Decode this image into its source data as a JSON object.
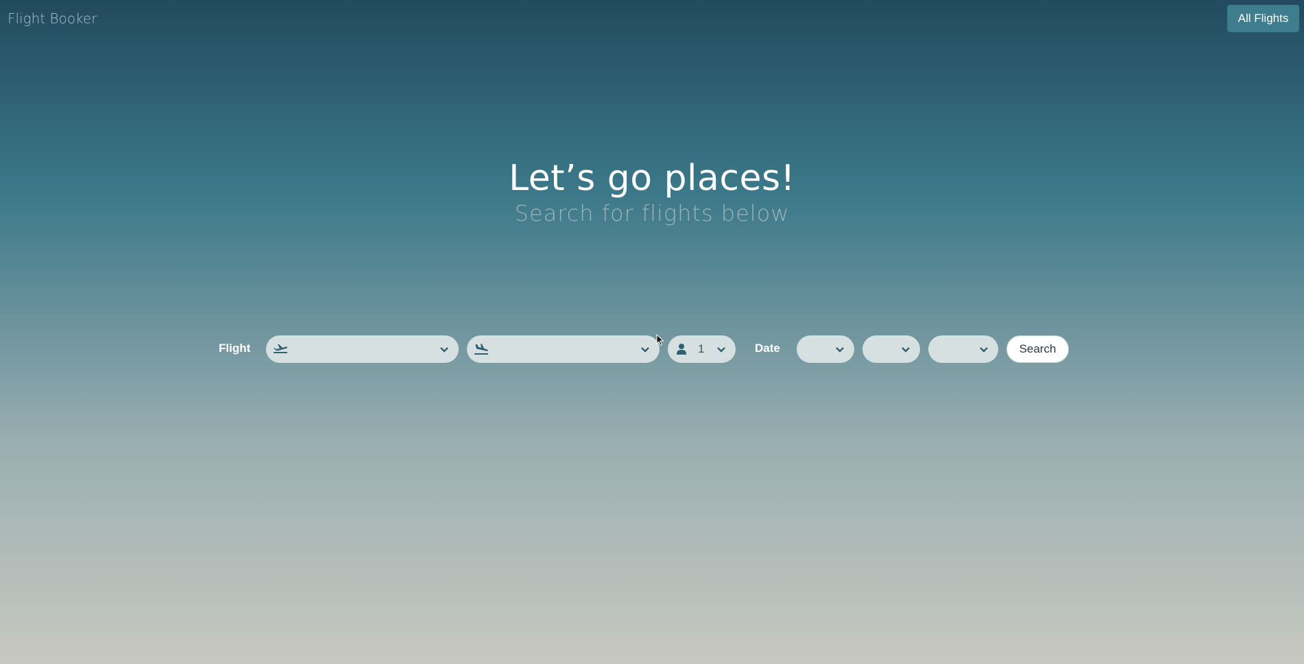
{
  "header": {
    "brand": "Flight Booker",
    "all_flights_label": "All Flights"
  },
  "hero": {
    "title": "Let’s go places!",
    "subtitle": "Search for flights below"
  },
  "search": {
    "flight_label": "Flight",
    "origin": {
      "icon": "plane-departure-icon",
      "value": ""
    },
    "destination": {
      "icon": "plane-arrival-icon",
      "value": ""
    },
    "passengers": {
      "icon": "user-icon",
      "value": "1"
    },
    "date_label": "Date",
    "date_selects": [
      {
        "value": ""
      },
      {
        "value": ""
      },
      {
        "value": ""
      }
    ],
    "search_label": "Search"
  },
  "colors": {
    "accent": "#3d7d8e",
    "pill_bg": "#d6e0e1",
    "icon": "#2f5f70"
  }
}
